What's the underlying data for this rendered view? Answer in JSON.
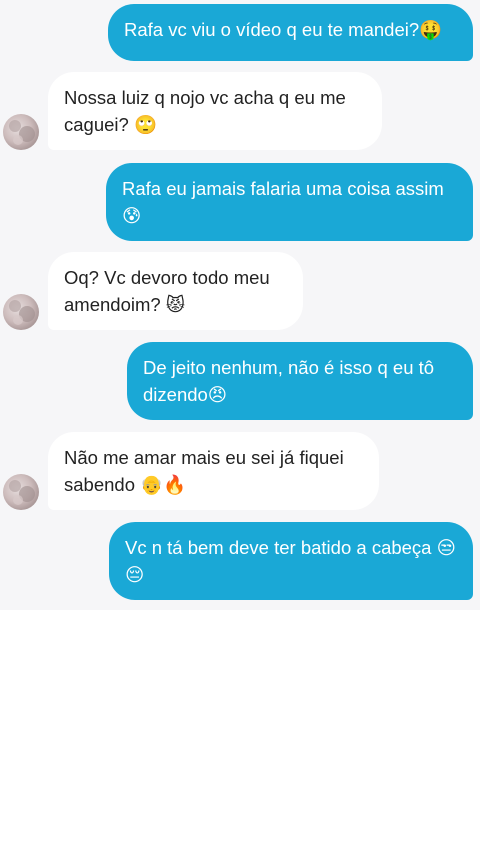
{
  "colors": {
    "outgoing_bubble": "#1aa8d6",
    "incoming_bubble": "#ffffff",
    "chat_background": "#f6f6f8"
  },
  "messages": [
    {
      "direction": "out",
      "text": "Rafa vc viu o vídeo q eu te mandei?🤑"
    },
    {
      "direction": "in",
      "text": "Nossa luiz q nojo vc acha q eu me caguei? 🙄"
    },
    {
      "direction": "out",
      "text": "Rafa eu jamais falaria uma coisa assim 😰"
    },
    {
      "direction": "in",
      "text": "Oq? Vc devoro todo meu amendoim? 😾"
    },
    {
      "direction": "out",
      "text": "De jeito nenhum, não é isso q eu tô dizendo😠"
    },
    {
      "direction": "in",
      "text": "Não me amar mais eu sei já fiquei sabendo 👴🔥"
    },
    {
      "direction": "out",
      "text": "Vc n tá bem deve ter batido a cabeça 😒😔"
    }
  ],
  "contact": {
    "avatar_icon": "contact-avatar"
  }
}
